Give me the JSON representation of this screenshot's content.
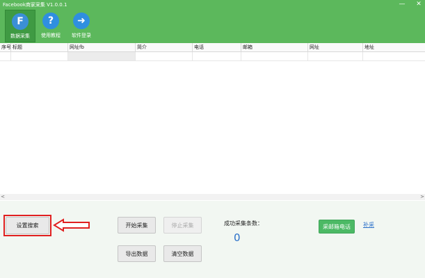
{
  "window": {
    "title": "Facebook商家采集 V1.0.0.1",
    "minimize": "—",
    "close": "✕"
  },
  "toolbar": [
    {
      "label": "数据采集",
      "icon_text": "F",
      "icon": "facebook-icon",
      "color": "#3b8fd6"
    },
    {
      "label": "使用教程",
      "icon_text": "?",
      "icon": "help-icon",
      "color": "#2f8fe0"
    },
    {
      "label": "软件登录",
      "icon_text": "➜",
      "icon": "login-arrow-icon",
      "color": "#2f8fe0"
    }
  ],
  "table": {
    "columns": [
      "序号",
      "标题",
      "网址fb",
      "简介",
      "电话",
      "邮箱",
      "网址",
      "地址"
    ]
  },
  "scrollbar": {
    "left": "<",
    "right": ">"
  },
  "controls": {
    "settings_search": "设置搜索",
    "start_collect": "开始采集",
    "stop_collect": "停止采集",
    "export_data": "导出数据",
    "clear_data": "清空数据",
    "collect_email_phone": "采邮箱电话",
    "supplement": "补采",
    "success_count_label": "成功采集条数：",
    "success_count": "0"
  },
  "colors": {
    "accent": "#5cb85c",
    "highlight": "#e02020",
    "link": "#2a6fc9"
  }
}
